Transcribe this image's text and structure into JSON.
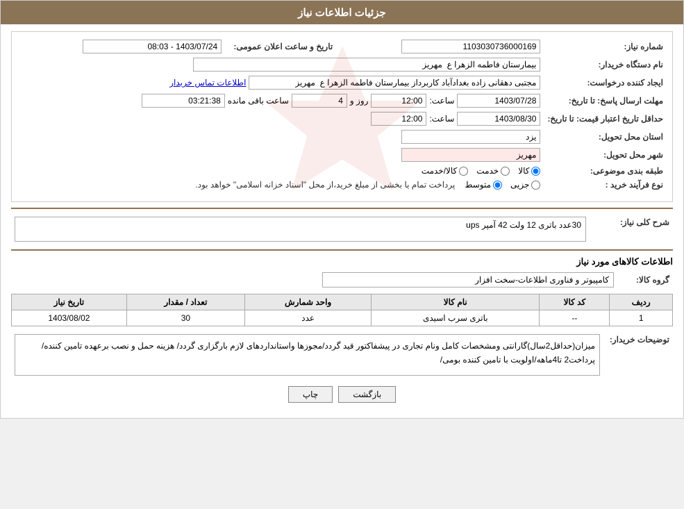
{
  "page": {
    "title": "جزئیات اطلاعات نیاز"
  },
  "header": {
    "needle_number_label": "شماره نیاز:",
    "needle_number_value": "1103030736000169",
    "announcement_date_label": "تاریخ و ساعت اعلان عمومی:",
    "announcement_date_value": "1403/07/24 - 08:03",
    "requester_name_label": "نام دستگاه خریدار:",
    "requester_name_value": "بیمارستان فاطمه الزهرا ع  مهریز",
    "creator_label": "ایجاد کننده درخواست:",
    "creator_value": "مجتبی دهقانی زاده بغدادآباد کاربرداز بیمارستان فاطمه الزهرا ع  مهریز",
    "contact_link": "اطلاعات تماس خریدار",
    "answer_deadline_label": "مهلت ارسال پاسخ: تا تاریخ:",
    "answer_deadline_date": "1403/07/28",
    "answer_deadline_time_label": "ساعت:",
    "answer_deadline_time": "12:00",
    "answer_deadline_days_label": "روز و",
    "answer_deadline_days": "4",
    "answer_deadline_remaining_label": "ساعت باقی مانده",
    "answer_deadline_remaining": "03:21:38",
    "price_validity_label": "حداقل تاریخ اعتبار قیمت: تا تاریخ:",
    "price_validity_date": "1403/08/30",
    "price_validity_time_label": "ساعت:",
    "price_validity_time": "12:00",
    "province_label": "استان محل تحویل:",
    "province_value": "یزد",
    "city_label": "شهر محل تحویل:",
    "city_value": "مهریز",
    "category_label": "طبقه بندی موضوعی:",
    "category_options": [
      "کالا",
      "خدمت",
      "کالا/خدمت"
    ],
    "category_selected": "کالا",
    "process_label": "نوع فرآیند خرید :",
    "process_options": [
      "جزیی",
      "متوسط"
    ],
    "process_selected": "متوسط",
    "process_note": "پرداخت تمام یا بخشی از مبلغ خرید،از محل \"اسناد خزانه اسلامی\" خواهد بود."
  },
  "summary": {
    "title": "شرح کلی نیاز:",
    "value": "30عدد باتری 12 ولت 42 آمپر ups"
  },
  "goods_title": "اطلاعات کالاهای مورد نیاز",
  "group_label": "گروه کالا:",
  "group_value": "کامپیوتر و فناوری اطلاعات-سخت افزار",
  "table": {
    "columns": [
      "ردیف",
      "کد کالا",
      "نام کالا",
      "واحد شمارش",
      "تعداد / مقدار",
      "تاریخ نیاز"
    ],
    "rows": [
      {
        "row": "1",
        "code": "--",
        "name": "باتری سرب اسیدی",
        "unit": "عدد",
        "quantity": "30",
        "date": "1403/08/02"
      }
    ]
  },
  "buyer_notes_label": "توضیحات خریدار:",
  "buyer_notes_value": "میزان(حداقل2سال)گارانتی ومشخصات کامل ونام تجاری در پیشفاکتور قید گردد/مجوزها واستانداردهای لازم بارگزاری گردد/ هزینه حمل و نصب برعهده تامین کننده/پرداخت2 تا4ماهه/اولویت با تامین کننده بومی/",
  "buttons": {
    "print": "چاپ",
    "back": "بازگشت"
  }
}
